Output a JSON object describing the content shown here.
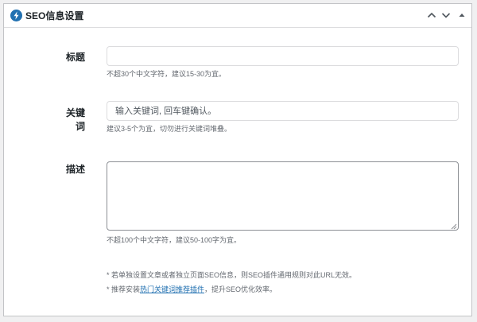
{
  "panel": {
    "title": "SEO信息设置",
    "icons": {
      "logo": "lightning-logo-icon",
      "move_up": "chevron-up-icon",
      "move_down": "chevron-down-icon",
      "toggle": "triangle-up-icon"
    },
    "accent": "#2271b1"
  },
  "fields": {
    "title": {
      "label": "标题",
      "value": "",
      "placeholder": "",
      "hint": "不超30个中文字符，建议15-30为宜。"
    },
    "keywords": {
      "label": "关键词",
      "value": "",
      "placeholder": "输入关键词, 回车键确认。",
      "hint": "建议3-5个为宜，切勿进行关键词堆叠。"
    },
    "description": {
      "label": "描述",
      "value": "",
      "hint": "不超100个中文字符，建议50-100字为宜。"
    }
  },
  "notes": {
    "line1": "* 若单独设置文章或者独立页面SEO信息，则SEO插件通用规则对此URL无效。",
    "line2_prefix": "* 推荐安装",
    "line2_link": "热门关键词推荐插件",
    "line2_suffix": "，提升SEO优化效率。"
  }
}
